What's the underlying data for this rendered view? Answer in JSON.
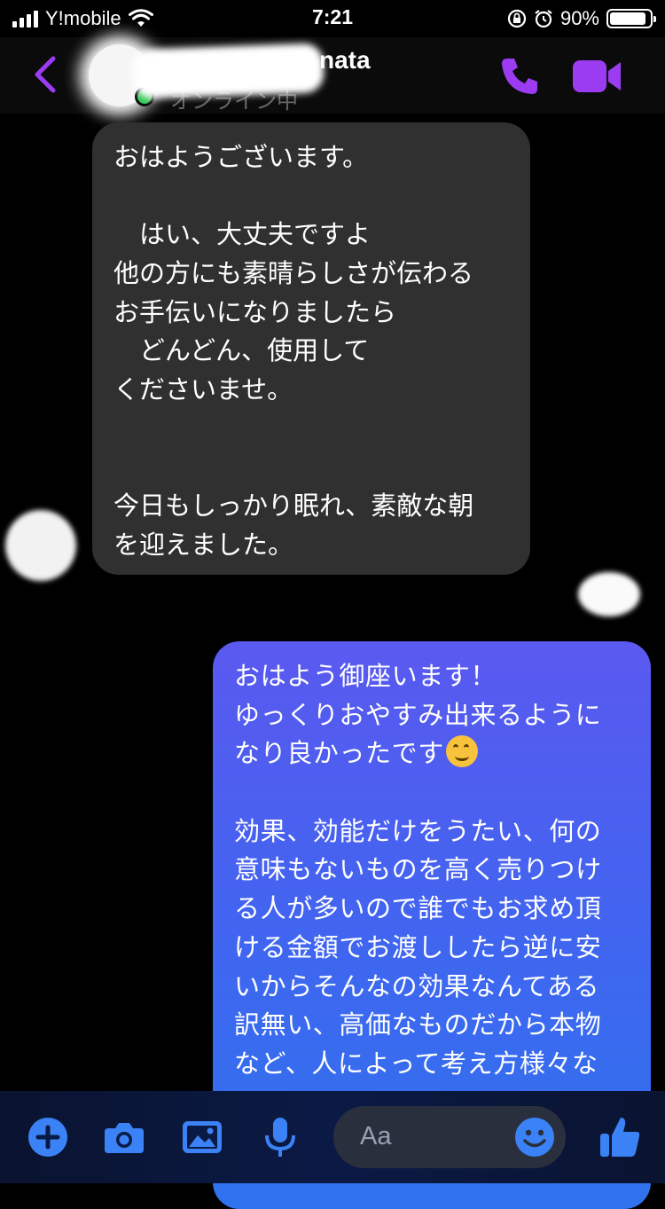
{
  "status_bar": {
    "carrier": "Y!mobile",
    "time": "7:21",
    "battery_percent": "90%",
    "battery_level": 0.9,
    "icons": [
      "signal-icon",
      "wifi-icon",
      "orientation-lock-icon",
      "alarm-icon",
      "battery-icon"
    ]
  },
  "header": {
    "contact_name_visible": "nata",
    "status_text": "オンライン中",
    "icons": [
      "back-chevron-icon",
      "phone-icon",
      "video-camera-icon"
    ],
    "accent_color": "#9b3cf2"
  },
  "messages": [
    {
      "direction": "incoming",
      "lines": [
        "おはようございます。",
        "",
        "　はい、大丈夫ですよ",
        "他の方にも素晴らしさが伝わる",
        "お手伝いになりましたら",
        "　どんどん、使用して",
        "くださいませ。",
        "",
        "",
        "今日もしっかり眠れ、素敵な朝",
        "を迎えました。"
      ]
    },
    {
      "direction": "outgoing",
      "lines": [
        "おはよう御座います！",
        "ゆっくりおやすみ出来るように",
        "なり良かったです",
        "",
        "効果、効能だけをうたい、何の",
        "意味もないものを高く売りつけ",
        "る人が多いので誰でもお求め頂",
        "ける金額でお渡ししたら逆に安",
        "いからそんなの効果なんてある",
        "訳無い、高価なものだから本物",
        "など、人によって考え方様々な"
      ],
      "emoji_after_line": 2,
      "emoji": "smiling-face-emoji"
    }
  ],
  "composer": {
    "placeholder": "Aa",
    "icons": [
      "plus-icon",
      "camera-icon",
      "image-icon",
      "microphone-icon",
      "emoji-icon",
      "thumbs-up-icon"
    ],
    "accent_color": "#3b82f6"
  }
}
